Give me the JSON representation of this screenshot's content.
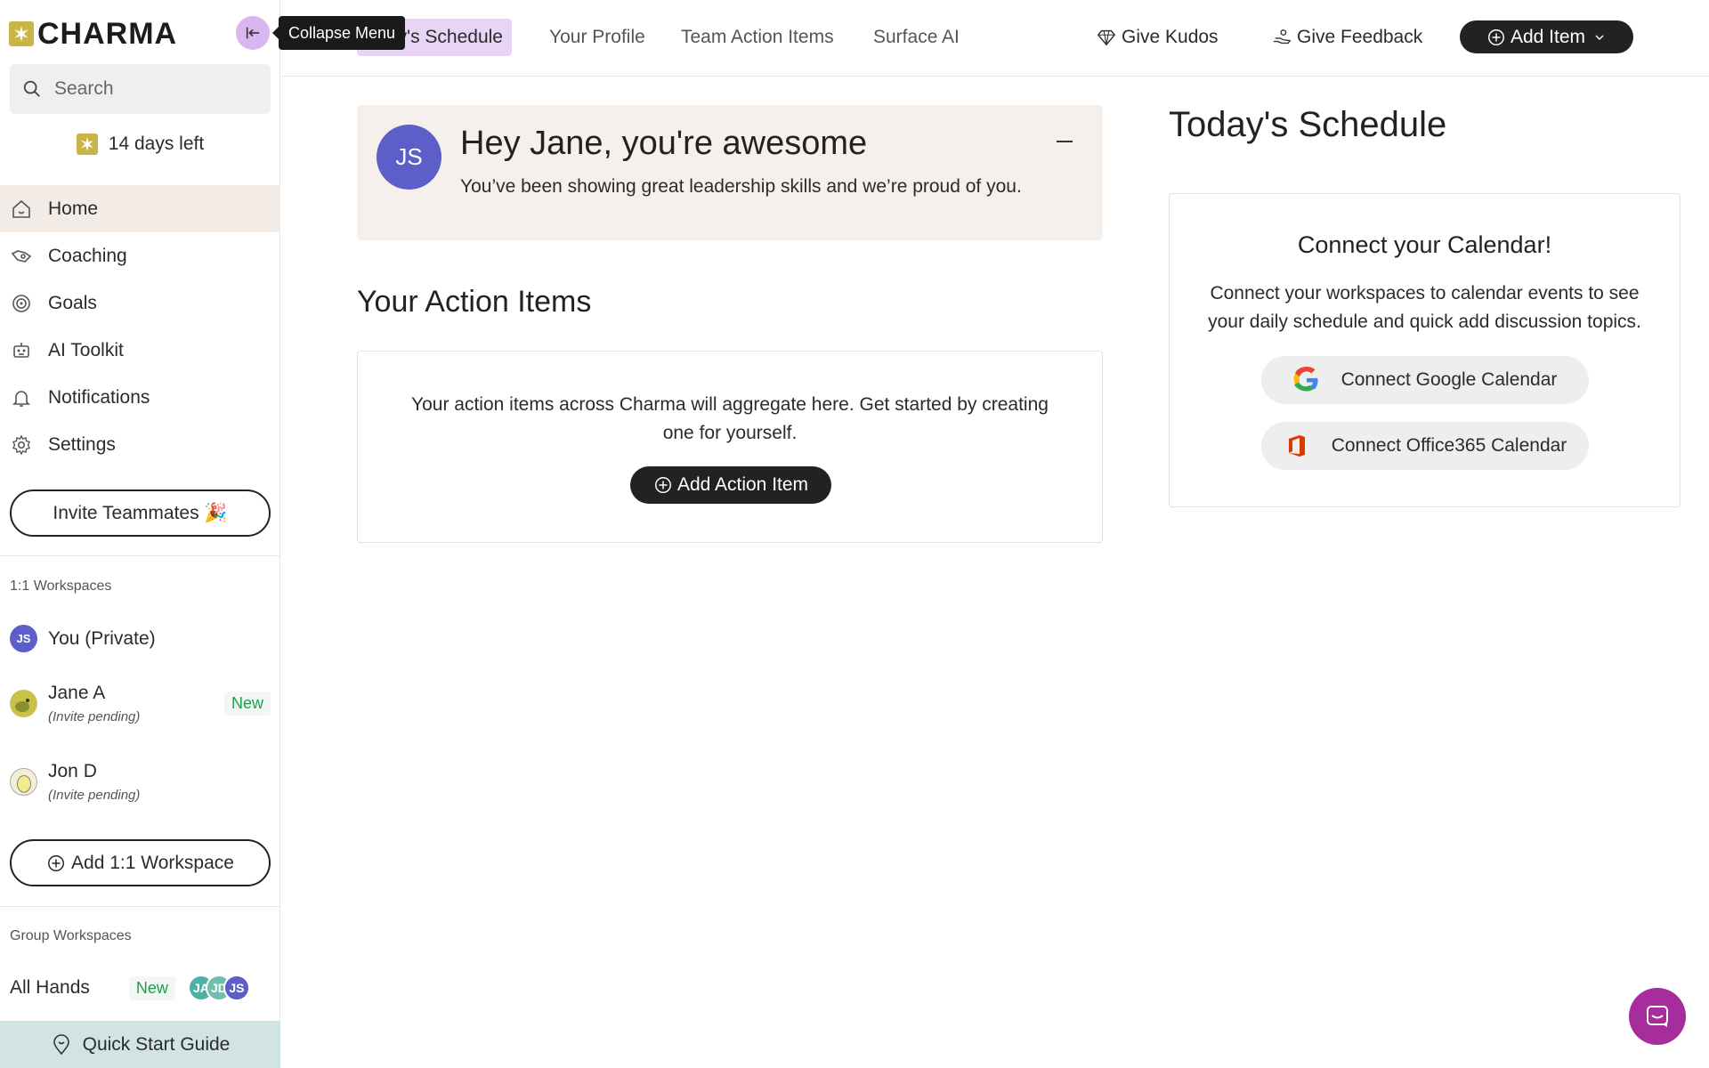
{
  "app": {
    "logo_text": "CHARMA"
  },
  "sidebar": {
    "collapse_tooltip": "Collapse Menu",
    "search_placeholder": "Search",
    "trial_text": "14 days left",
    "nav": [
      {
        "label": "Home",
        "icon": "home-icon"
      },
      {
        "label": "Coaching",
        "icon": "coaching-icon"
      },
      {
        "label": "Goals",
        "icon": "target-icon"
      },
      {
        "label": "AI Toolkit",
        "icon": "robot-icon"
      },
      {
        "label": "Notifications",
        "icon": "bell-icon"
      },
      {
        "label": "Settings",
        "icon": "gear-icon"
      }
    ],
    "invite_label": "Invite Teammates 🎉",
    "one_on_one_label": "1:1 Workspaces",
    "one_on_one": [
      {
        "name": "You (Private)",
        "initials": "JS",
        "sub": "",
        "badge": ""
      },
      {
        "name": "Jane A",
        "initials": "",
        "sub": "(Invite pending)",
        "badge": "New"
      },
      {
        "name": "Jon D",
        "initials": "",
        "sub": "(Invite pending)",
        "badge": ""
      }
    ],
    "add_workspace_label": "Add 1:1 Workspace",
    "group_label": "Group Workspaces",
    "group": [
      {
        "name": "All Hands",
        "badge": "New",
        "members": [
          "JA",
          "JD",
          "JS"
        ]
      }
    ],
    "quickstart_label": "Quick Start Guide"
  },
  "topbar": {
    "tabs": [
      "Today's Schedule",
      "Your Profile",
      "Team Action Items",
      "Surface AI"
    ],
    "active_tab": 0,
    "visible_active_tab_text": "y's Schedule",
    "kudos_label": "Give Kudos",
    "feedback_label": "Give Feedback",
    "add_item_label": "Add Item"
  },
  "hero": {
    "initials": "JS",
    "title": "Hey Jane, you're awesome",
    "subtitle": "You’ve been showing great leadership skills and we’re proud of you."
  },
  "action_items": {
    "heading": "Your Action Items",
    "empty_text": "Your action items across Charma will aggregate here. Get started by creating one for yourself.",
    "button_label": "Add Action Item"
  },
  "schedule": {
    "heading": "Today's Schedule",
    "card_title": "Connect your Calendar!",
    "card_text": "Connect your workspaces to calendar events to see your daily schedule and quick add discussion topics.",
    "google_label": "Connect Google Calendar",
    "office_label": "Connect Office365 Calendar"
  },
  "colors": {
    "accent_purple": "#d9b6ef",
    "active_tab_bg": "#e8d4f5",
    "logo_yellow": "#c8b545",
    "avatar_blue": "#5b5fc7",
    "chat_fab": "#a62d9b",
    "quickstart_bg": "#d2e3e4",
    "new_badge": "#1e9e4b"
  }
}
